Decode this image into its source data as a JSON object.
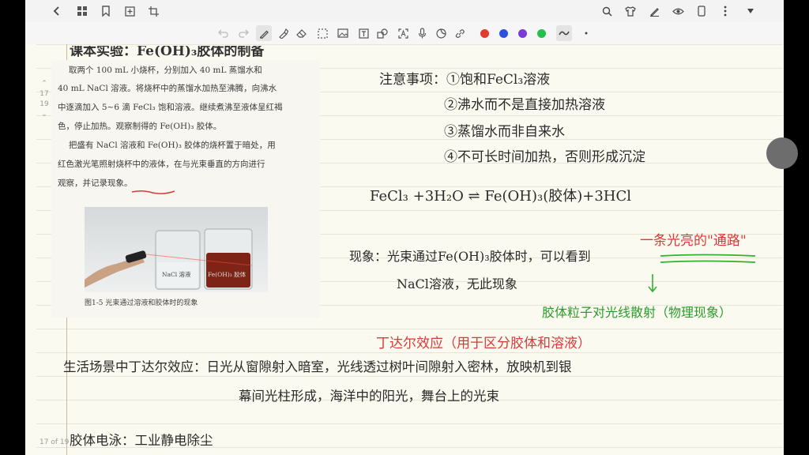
{
  "window": {
    "left_icons": [
      "chevron-left-icon",
      "grid-icon",
      "bookmark-icon",
      "add-page-icon",
      "crop-icon"
    ],
    "right_icons": [
      "search-icon",
      "shirt-icon",
      "pen-settings-icon",
      "eye-icon",
      "tablet-icon",
      "more-vertical-icon",
      "heart-icon"
    ]
  },
  "toolbar": {
    "tools": [
      "undo-icon",
      "redo-icon",
      "pen-icon",
      "highlighter-icon",
      "eraser-icon",
      "lasso-icon",
      "image-icon",
      "text-icon",
      "shape-icon",
      "ocr-icon",
      "mic-icon",
      "sticker-icon",
      "link-icon"
    ],
    "colors": [
      "#e23b30",
      "#2b4fe0",
      "#7a3ad6",
      "#27c04c",
      "#404040"
    ]
  },
  "page_indicator": {
    "page_top": "17",
    "page_mid": "19"
  },
  "footer": {
    "page_count": "17 of 19"
  },
  "book": {
    "lines": [
      "取两个 100 mL 小烧杯，分别加入 40 mL 蒸馏水和",
      "40 mL NaCl 溶液。将烧杯中的蒸馏水加热至沸腾，向沸水",
      "中逐滴加入 5~6 滴 FeCl₃ 饱和溶液。继续煮沸至液体呈红褐",
      "色，停止加热。观察制得的 Fe(OH)₃ 胶体。",
      "把盛有 NaCl 溶液和 Fe(OH)₃ 胶体的烧杯置于暗处，用",
      "红色激光笔照射烧杯中的液体，在与光束垂直的方向进行",
      "观察，并记录现象。"
    ],
    "photo_labels": [
      "NaCl 溶液",
      "Fe(OH)₃ 胶体"
    ],
    "caption": "图1-5  光束通过溶液和胶体时的现象"
  },
  "notes": {
    "title_fragment": "课本实验：Fe(OH)₃胶体的制备",
    "cautions": [
      "注意事项：①饱和FeCl₃溶液",
      "②沸水而不是直接加热溶液",
      "③蒸馏水而非自来水",
      "④不可长时间加热，否则形成沉淀"
    ],
    "equation": "FeCl₃ +3H₂O ⇌ Fe(OH)₃(胶体)+3HCl",
    "phenomenon_1": "现象：光束通过Fe(OH)₃胶体时，可以看到",
    "phenomenon_red": "一条光亮的\"通路\"",
    "phenomenon_2": "NaCl溶液，无此现象",
    "green_note": "胶体粒子对光线散射（物理现象）",
    "tyndall": "丁达尔效应（用于区分胶体和溶液）",
    "life_1": "生活场景中丁达尔效应：日光从窗隙射入暗室，光线透过树叶间隙射入密林，放映机到银",
    "life_2": "幕间光柱形成，海洋中的阳光，舞台上的光束",
    "bottom": "胶体电泳：工业静电除尘"
  }
}
